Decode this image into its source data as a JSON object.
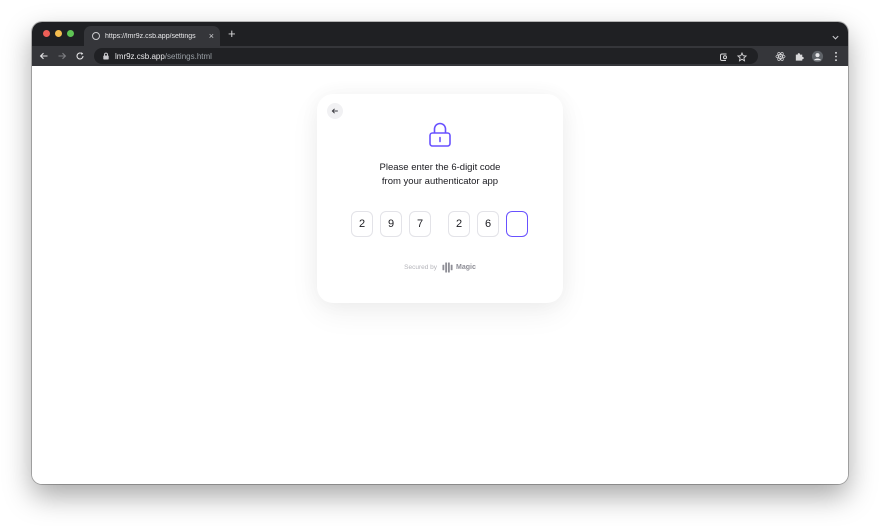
{
  "browser": {
    "tab": {
      "title": "https://lmr9z.csb.app/settings",
      "close_glyph": "×",
      "favicon": "globe-icon"
    },
    "new_tab_glyph": "+",
    "address": {
      "host": "lmr9z.csb.app",
      "path": "/settings.html"
    },
    "icons": [
      "back-arrow-icon",
      "forward-arrow-icon",
      "reload-icon",
      "lock-icon",
      "google-lens-icon",
      "bookmark-star-icon",
      "react-devtools-icon",
      "extensions-puzzle-icon",
      "profile-icon",
      "kebab-menu-icon",
      "tab-search-chevron-icon"
    ]
  },
  "auth_card": {
    "back_icon": "arrow-left-icon",
    "lock_icon": "padlock-icon",
    "prompt_line1": "Please enter the 6-digit code",
    "prompt_line2": "from your authenticator app",
    "code_digits": [
      "2",
      "9",
      "7",
      "2",
      "6",
      ""
    ],
    "active_index": 5,
    "footer_label": "Secured by",
    "brand_name": "Magic"
  },
  "colors": {
    "accent": "#6851ff",
    "text": "#1b1b20",
    "muted": "#b4b4ba",
    "chrome_dark": "#1f2023",
    "chrome_toolbar": "#35363a"
  }
}
